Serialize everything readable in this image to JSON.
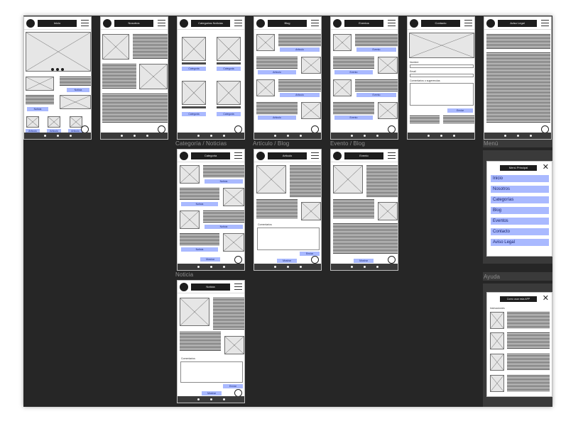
{
  "sections": {
    "categoria_noticias": "Categoría / Noticias",
    "articulo_blog": "Artículo / Blog",
    "evento_blog": "Evento / Blog",
    "noticia": "Noticia",
    "menu": "Menú",
    "ayuda": "Ayuda"
  },
  "screens": {
    "inicio": {
      "title": "Inicio",
      "buttons": [
        "Noticia",
        "Noticia",
        "Articulo",
        "Articulo",
        "Articulo"
      ]
    },
    "nosotros": {
      "title": "Nosotros"
    },
    "categorias": {
      "title": "Categorias Noticias",
      "buttons": [
        "Categoria",
        "Categoria",
        "Categoria",
        "Categoria"
      ]
    },
    "blog": {
      "title": "Blog",
      "buttons": [
        "Articulo",
        "Articulo",
        "Articulo",
        "Articulo"
      ]
    },
    "eventos": {
      "title": "Eventos",
      "buttons": [
        "Evento",
        "Evento",
        "Evento",
        "Evento"
      ]
    },
    "contacto": {
      "title": "Contacto",
      "labels": [
        "Nombre",
        "Email",
        "Comentarios o sugerencias"
      ],
      "send": "Enviar"
    },
    "aviso": {
      "title": "Aviso Legal"
    },
    "categoria": {
      "title": "Categoria",
      "buttons": [
        "Noticia",
        "Noticia",
        "Noticia",
        "Noticia"
      ],
      "more": "Mostrar"
    },
    "articulo": {
      "title": "Articulo",
      "comments": "Comentarios",
      "send": "Enviar",
      "more": "Mostrar"
    },
    "evento": {
      "title": "Evento",
      "more": "Mostrar"
    },
    "noticia": {
      "title": "Noticia",
      "comments": "Comentarios",
      "send": "Enviar",
      "more": "Mostrar"
    }
  },
  "menu": {
    "title": "Menú Principal",
    "close": "✕",
    "items": [
      "Inicio",
      "Nosotros",
      "Categorías",
      "Blog",
      "Eventos",
      "Contacto",
      "Aviso Legal"
    ]
  },
  "help": {
    "title": "Como usar esta APP",
    "subtitle": "Instrucciones",
    "close": "✕"
  },
  "colors": {
    "board": "#262626",
    "button": "#a9b9ff",
    "header_bar": "#1d1d1d"
  }
}
